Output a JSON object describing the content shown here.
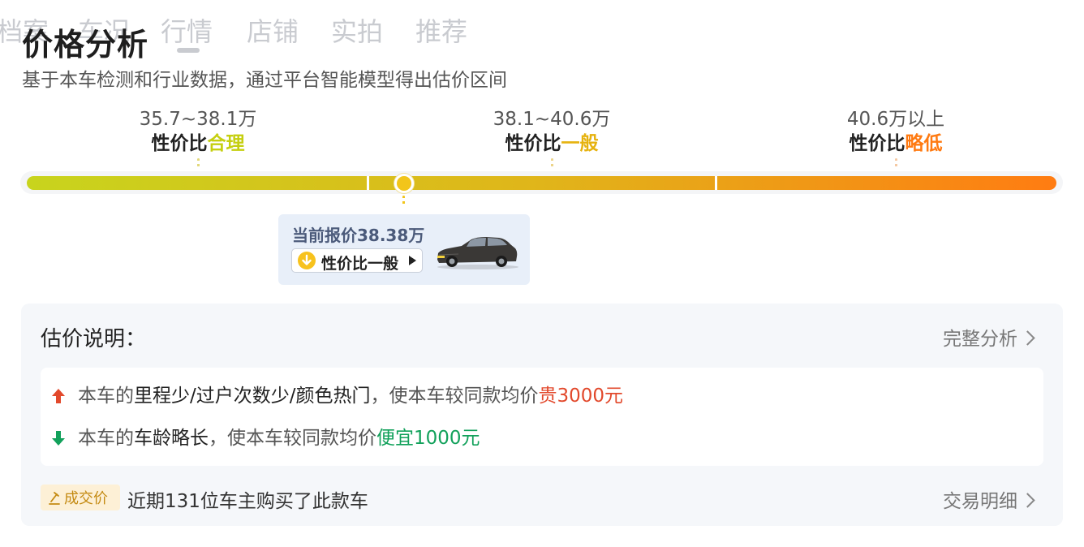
{
  "tabs": [
    "档案",
    "车况",
    "行情",
    "店铺",
    "实拍",
    "推荐"
  ],
  "section": {
    "title": "价格分析",
    "subtitle": "基于本车检测和行业数据，通过平台智能模型得出估价区间"
  },
  "ranges": [
    {
      "price": "35.7~38.1万",
      "prefix": "性价比",
      "level": "合理",
      "color": "#c5cf0f"
    },
    {
      "price": "38.1~40.6万",
      "prefix": "性价比",
      "level": "一般",
      "color": "#e6b20e"
    },
    {
      "price": "40.6万以上",
      "prefix": "性价比",
      "level": "略低",
      "color": "#ff7a11"
    }
  ],
  "current_quote": {
    "label": "当前报价38.38万",
    "rating": "性价比一般",
    "position_fraction": 0.366
  },
  "explanation": {
    "title": "估价说明：",
    "link": "完整分析",
    "factors": [
      {
        "prefix": "本车的",
        "highlight": "里程少/过户次数少/颜色热门",
        "middle": "，使本车较同款均价",
        "effect": "贵3000元",
        "direction": "up"
      },
      {
        "prefix": "本车的",
        "highlight": "车龄略长",
        "middle": "，使本车较同款均价",
        "effect": "便宜1000元",
        "direction": "down"
      }
    ]
  },
  "deal": {
    "badge": "成交价",
    "text": "近期131位车主购买了此款车",
    "link": "交易明细"
  },
  "colors": {
    "reasonable": "#c5cf0f",
    "average": "#e6b20e",
    "low": "#ff7a11",
    "price_up": "#e2492c",
    "price_down": "#12a15b",
    "quote_text": "#4b5a7a"
  }
}
